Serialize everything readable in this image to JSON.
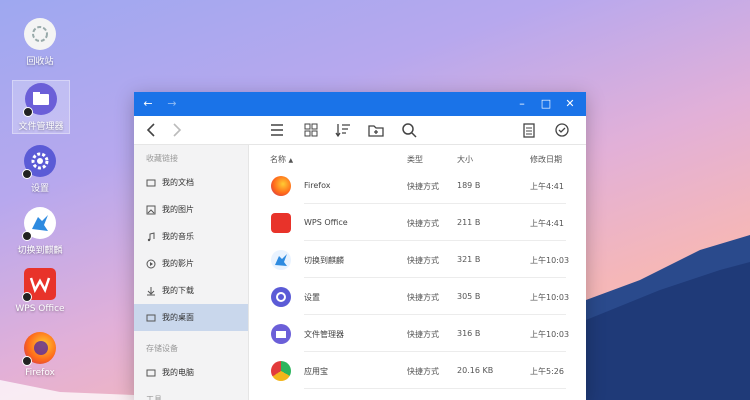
{
  "desktop": {
    "icons": [
      {
        "label": "回收站"
      },
      {
        "label": "文件管理器"
      },
      {
        "label": "设置"
      },
      {
        "label": "切换到麒麟"
      },
      {
        "label": "WPS Office"
      },
      {
        "label": "Firefox"
      }
    ]
  },
  "window": {
    "titlebar": {
      "back": "←",
      "minimize": "–",
      "maximize": "□",
      "close": "✕"
    },
    "sidebar": {
      "section_favorites": "收藏链接",
      "favorites": [
        {
          "label": "我的文档"
        },
        {
          "label": "我的图片"
        },
        {
          "label": "我的音乐"
        },
        {
          "label": "我的影片"
        },
        {
          "label": "我的下载"
        },
        {
          "label": "我的桌面"
        }
      ],
      "section_devices": "存储设备",
      "devices": [
        {
          "label": "我的电脑"
        }
      ],
      "section_tools": "工具"
    },
    "columns": {
      "name": "名称",
      "type": "类型",
      "size": "大小",
      "date": "修改日期"
    },
    "files": [
      {
        "name": "Firefox",
        "type": "快捷方式",
        "size": "189 B",
        "date": "上午4:41"
      },
      {
        "name": "WPS Office",
        "type": "快捷方式",
        "size": "211 B",
        "date": "上午4:41"
      },
      {
        "name": "切换到麒麟",
        "type": "快捷方式",
        "size": "321 B",
        "date": "上午10:03"
      },
      {
        "name": "设置",
        "type": "快捷方式",
        "size": "305 B",
        "date": "上午10:03"
      },
      {
        "name": "文件管理器",
        "type": "快捷方式",
        "size": "316 B",
        "date": "上午10:03"
      },
      {
        "name": "应用宝",
        "type": "快捷方式",
        "size": "20.16 KB",
        "date": "上午5:26"
      }
    ]
  },
  "colors": {
    "titlebar": "#1a73e8",
    "sidebar_active": "#c9d7ec",
    "mountain": "#1f3a78"
  }
}
